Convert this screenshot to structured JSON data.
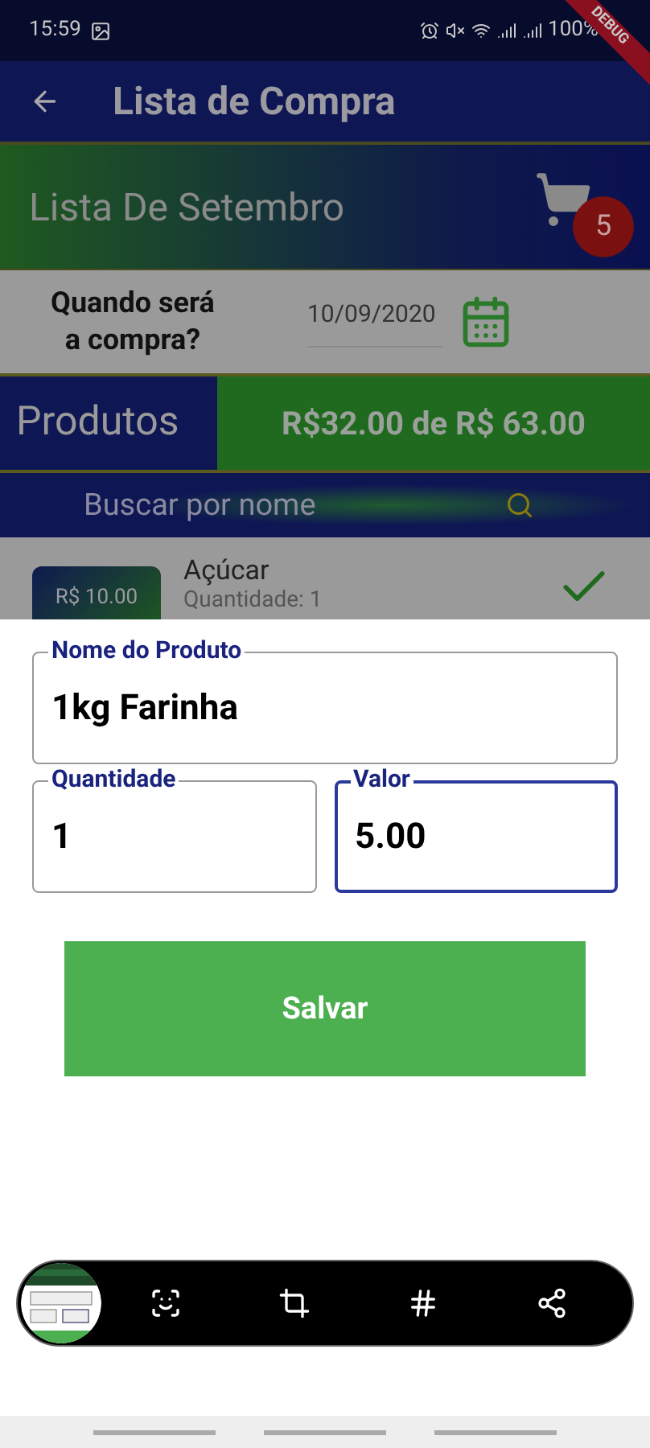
{
  "status_bar": {
    "time": "15:59",
    "battery": "100%"
  },
  "debug_banner": "DEBUG",
  "app_bar": {
    "title": "Lista de Compra"
  },
  "list_header": {
    "name": "Lista De Setembro",
    "cart_count": "5"
  },
  "date_row": {
    "question": "Quando será a compra?",
    "date": "10/09/2020"
  },
  "totals": {
    "label": "Produtos",
    "amount": "R$32.00 de R$ 63.00"
  },
  "search": {
    "placeholder": "Buscar por nome"
  },
  "products": [
    {
      "price": "R$ 10.00",
      "name": "Açúcar",
      "quantity": "Quantidade: 1",
      "checked": true
    }
  ],
  "form": {
    "fields": [
      {
        "label": "Nome do Produto",
        "value": "1kg Farinha",
        "focused": false
      },
      {
        "label": "Quantidade",
        "value": "1",
        "focused": false
      },
      {
        "label": "Valor",
        "value": "5.00",
        "focused": true
      }
    ],
    "button": "Salvar"
  }
}
